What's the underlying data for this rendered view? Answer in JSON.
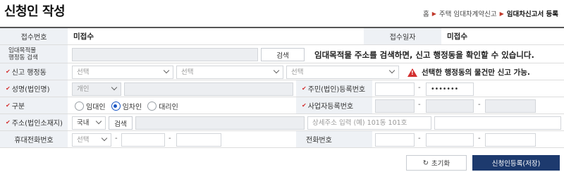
{
  "page": {
    "title": "신청인 작성",
    "breadcrumb": [
      "홈",
      "주택 임대차계약신고",
      "임대차신고서 등록"
    ]
  },
  "rows": {
    "receipt": {
      "number_label": "접수번호",
      "number_value": "미접수",
      "date_label": "접수일자",
      "date_value": "미접수"
    },
    "address_search": {
      "label_line1": "임대목적물",
      "label_line2": "행정동 검색",
      "search_button": "검색",
      "notice": "임대목적물 주소를 검색하면, 신고 행정동을 확인할 수 있습니다."
    },
    "district": {
      "label": "신고 행정동",
      "select1": "선택",
      "select2": "선택",
      "select3": "선택",
      "warning": "선택한 행정동의 물건만 신고 가능."
    },
    "name": {
      "label": "성명(법인명)",
      "type_select": "개인",
      "name_value": "",
      "reg_label": "주민(법인)등록번호",
      "reg_masked": "•••••••"
    },
    "category": {
      "label": "구분",
      "options": [
        "임대인",
        "임차인",
        "대리인"
      ],
      "selected": "임차인",
      "biz_label": "사업자등록번호"
    },
    "address": {
      "label": "주소(법인소재지)",
      "country_select": "국내",
      "search_button": "검색",
      "detail_placeholder": "상세주소 입력 (예) 101동 101호"
    },
    "phone": {
      "mobile_label": "휴대전화번호",
      "mobile_select": "선택",
      "tel_label": "전화번호"
    }
  },
  "buttons": {
    "reset": "초기화",
    "submit": "신청인등록(저장)"
  },
  "icons": {
    "required_mark": "✔",
    "reset_icon": "↻",
    "warning_icon": "!"
  },
  "colors": {
    "accent": "#1d3a6e",
    "required": "#d32f2f",
    "radio": "#1a56c4"
  }
}
